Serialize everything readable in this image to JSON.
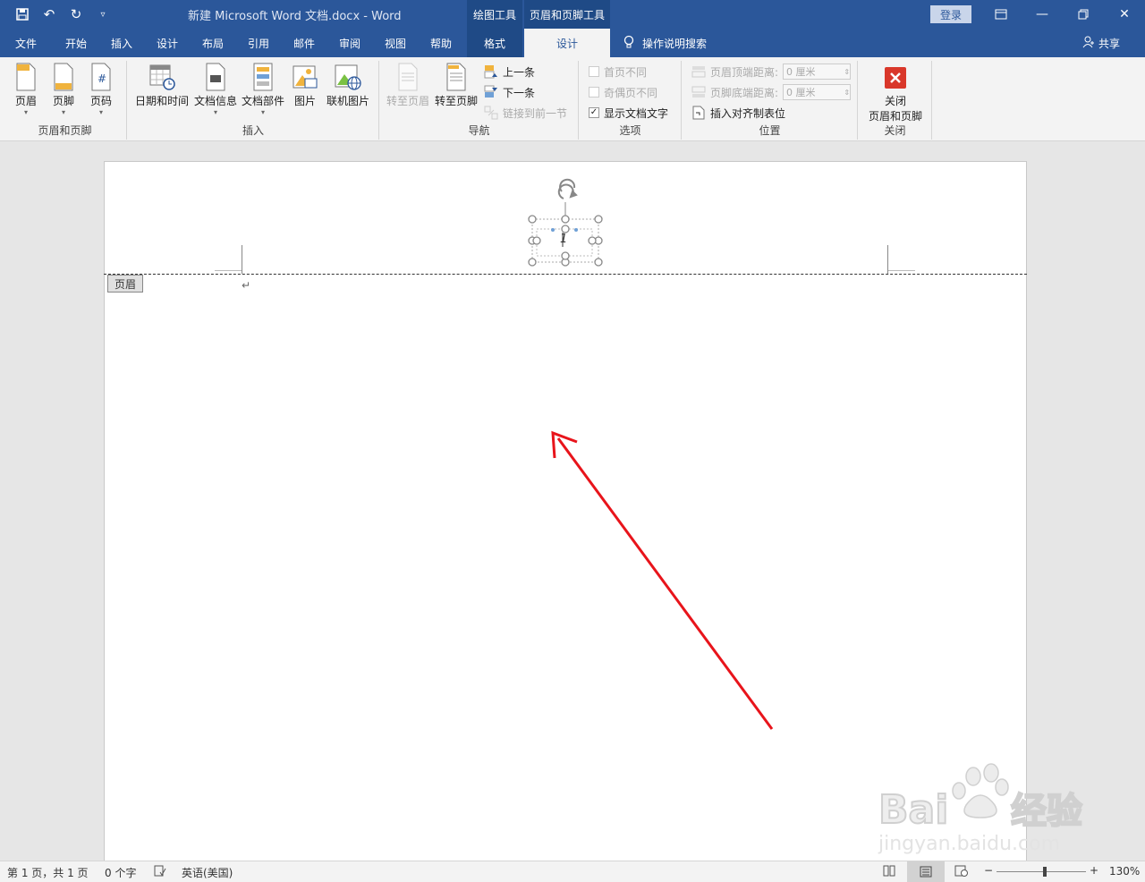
{
  "title_bar": {
    "doc_title": "新建 Microsoft Word 文档.docx  -  Word",
    "tool_tab_drawing": "绘图工具",
    "tool_tab_header": "页眉和页脚工具",
    "login": "登录"
  },
  "tabs": {
    "file": "文件",
    "home": "开始",
    "insert": "插入",
    "design": "设计",
    "layout": "布局",
    "references": "引用",
    "mailings": "邮件",
    "review": "审阅",
    "view": "视图",
    "help": "帮助",
    "format": "格式",
    "hf_design": "设计",
    "search": "操作说明搜索",
    "share": "共享"
  },
  "ribbon": {
    "group_hf": {
      "label": "页眉和页脚",
      "header": "页眉",
      "footer": "页脚",
      "page_number": "页码"
    },
    "group_insert": {
      "label": "插入",
      "date_time": "日期和时间",
      "doc_info": "文档信息",
      "doc_parts": "文档部件",
      "picture": "图片",
      "online_picture": "联机图片"
    },
    "group_nav": {
      "label": "导航",
      "goto_header": "转至页眉",
      "goto_footer": "转至页脚",
      "previous": "上一条",
      "next": "下一条",
      "link_previous": "链接到前一节"
    },
    "group_options": {
      "label": "选项",
      "first_page_diff": "首页不同",
      "odd_even_diff": "奇偶页不同",
      "show_doc_text": "显示文档文字",
      "show_doc_text_checked": true
    },
    "group_position": {
      "label": "位置",
      "header_top": "页眉顶端距离:",
      "footer_bottom": "页脚底端距离:",
      "header_top_value": "0 厘米",
      "footer_bottom_value": "0 厘米",
      "insert_align_tab": "插入对齐制表位"
    },
    "group_close": {
      "label": "关闭",
      "close_line1": "关闭",
      "close_line2": "页眉和页脚"
    }
  },
  "document": {
    "header_tag": "页眉",
    "page_number_text": "1",
    "paragraph_mark": "↵"
  },
  "status_bar": {
    "page_info": "第 1 页，共 1 页",
    "word_count": "0 个字",
    "language": "英语(美国)",
    "zoom": "130%"
  },
  "colors": {
    "brand": "#2b579a",
    "arrow": "#e8141b"
  },
  "zoom_level": 130
}
